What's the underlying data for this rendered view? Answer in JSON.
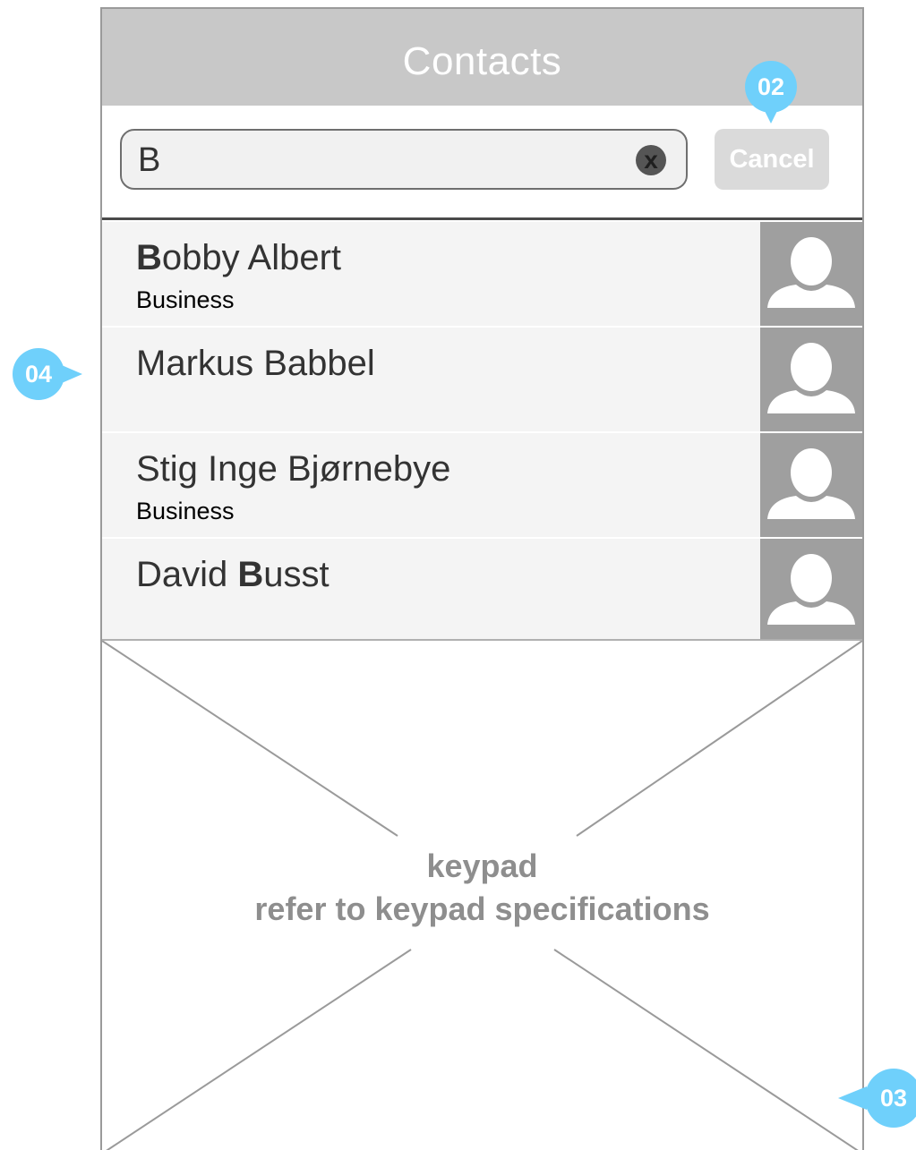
{
  "header": {
    "title": "Contacts"
  },
  "search": {
    "value": "B",
    "clear_glyph": "x",
    "cancel_label": "Cancel"
  },
  "contacts": [
    {
      "highlight": "B",
      "name_rest": "obby Albert",
      "name_prefix": "",
      "subtitle": "Business"
    },
    {
      "highlight": "",
      "name_rest": "",
      "name_prefix": "Markus Babbel",
      "subtitle": ""
    },
    {
      "highlight": "",
      "name_rest": "",
      "name_prefix": "Stig Inge Bjørnebye",
      "subtitle": "Business"
    },
    {
      "highlight": "B",
      "name_rest": "usst",
      "name_prefix": "David ",
      "subtitle": ""
    }
  ],
  "keypad": {
    "line1": "keypad",
    "line2": "refer to keypad specifications"
  },
  "callouts": {
    "c02": "02",
    "c03": "03",
    "c04": "04"
  },
  "colors": {
    "header": "#c8c8c8",
    "callout": "#6fd0fb",
    "avatar": "#9f9f9f",
    "row": "#f4f4f4"
  },
  "icons": {
    "clear": "clear-icon",
    "avatar": "person-icon"
  }
}
